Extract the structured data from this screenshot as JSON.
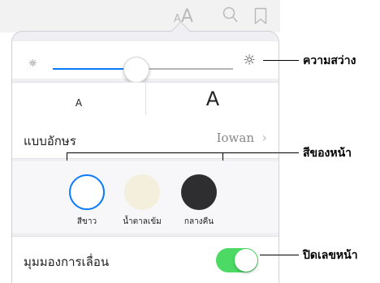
{
  "toolbar": {
    "text_size_glyph": "AA",
    "search_glyph": "⌕",
    "bookmark_glyph": "🔖"
  },
  "brightness": {
    "level": 0.46,
    "min_icon": "sun-small-icon",
    "max_icon": "sun-large-icon",
    "min_glyph": "☼",
    "max_glyph": "☼",
    "track_active_color": "#0a7aff",
    "track_inactive_color": "#b5b5b5"
  },
  "font_size": {
    "smaller_label": "A",
    "larger_label": "A"
  },
  "font": {
    "label": "แบบอักษร",
    "value": "Iowan",
    "chevron": "›"
  },
  "themes": [
    {
      "label": "สีขาว",
      "color": "#ffffff",
      "selected": true
    },
    {
      "label": "น้ำตาลเข้ม",
      "color": "#f4eedd",
      "selected": false
    },
    {
      "label": "กลางคืน",
      "color": "#2e2e30",
      "selected": false
    }
  ],
  "scrolling": {
    "label": "มุมมองการเลื่อน",
    "enabled": true,
    "on_color": "#4cd964"
  },
  "callouts": {
    "brightness": "ความสว่าง",
    "themes": "สีของหน้า",
    "scrolling": "ปิดเลขหน้า"
  }
}
